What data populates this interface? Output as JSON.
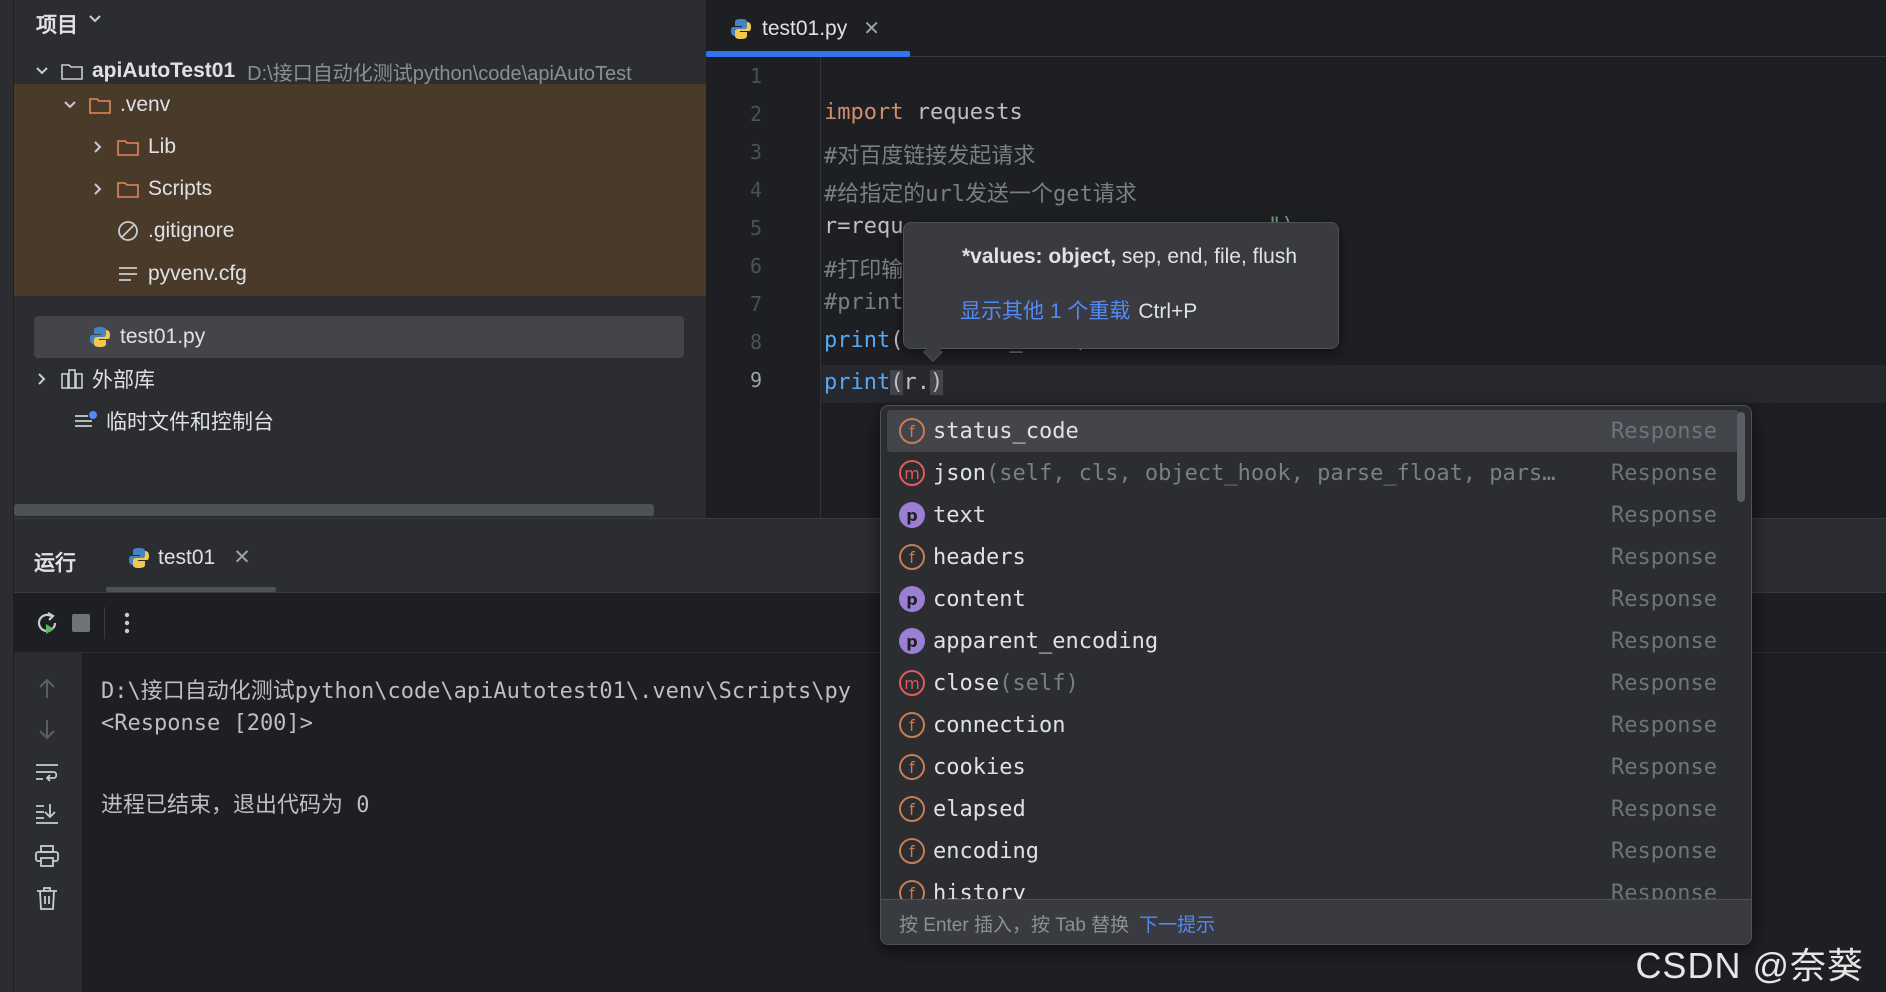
{
  "project": {
    "title": "项目",
    "root": {
      "name": "apiAutoTest01",
      "path": "D:\\接口自动化测试python\\code\\apiAutoTest"
    },
    "tree": [
      {
        "label": ".venv"
      },
      {
        "label": "Lib"
      },
      {
        "label": "Scripts"
      },
      {
        "label": ".gitignore"
      },
      {
        "label": "pyvenv.cfg"
      },
      {
        "label": "test01.py"
      },
      {
        "label": "外部库"
      },
      {
        "label": "临时文件和控制台"
      }
    ]
  },
  "editor": {
    "tab": {
      "label": "test01.py",
      "close": "✕"
    },
    "line_numbers": [
      "1",
      "2",
      "3",
      "4",
      "5",
      "6",
      "7",
      "8",
      "9"
    ],
    "lines": {
      "l2_kw": "import",
      "l2_rest": " requests",
      "l3": "#对百度链接发起请求",
      "l4": "#给指定的url发送一个get请求",
      "l5_a": "r=requ",
      "l5_b": "\")",
      "l6": "#打印输",
      "l7": "#print",
      "l8_fn": "print",
      "l8_rest": "(r.status_code)",
      "l9_fn": "print",
      "l9_open": "(",
      "l9_mid": "r.",
      "l9_close": ")"
    }
  },
  "param_info": {
    "signature_bold": "*values: object,",
    "signature_rest": " sep, end, file, flush",
    "more_link": "显示其他 1 个重载",
    "more_key": "Ctrl+P"
  },
  "completion": {
    "items": [
      {
        "kind": "f",
        "name": "status_code",
        "params": "",
        "type": "Response"
      },
      {
        "kind": "m",
        "name": "json",
        "params": "(self, cls, object_hook, parse_float, pars…",
        "type": "Response"
      },
      {
        "kind": "p",
        "name": "text",
        "params": "",
        "type": "Response"
      },
      {
        "kind": "f",
        "name": "headers",
        "params": "",
        "type": "Response"
      },
      {
        "kind": "p",
        "name": "content",
        "params": "",
        "type": "Response"
      },
      {
        "kind": "p",
        "name": "apparent_encoding",
        "params": "",
        "type": "Response"
      },
      {
        "kind": "m",
        "name": "close",
        "params": "(self)",
        "type": "Response"
      },
      {
        "kind": "f",
        "name": "connection",
        "params": "",
        "type": "Response"
      },
      {
        "kind": "f",
        "name": "cookies",
        "params": "",
        "type": "Response"
      },
      {
        "kind": "f",
        "name": "elapsed",
        "params": "",
        "type": "Response"
      },
      {
        "kind": "f",
        "name": "encoding",
        "params": "",
        "type": "Response"
      },
      {
        "kind": "f",
        "name": "history",
        "params": "",
        "type": "Response"
      }
    ],
    "footer_text": "按 Enter 插入，按 Tab 替换",
    "footer_link": "下一提示"
  },
  "run": {
    "title": "运行",
    "tab_label": "test01",
    "close": "✕",
    "output": [
      "D:\\接口自动化测试python\\code\\apiAutotest01\\.venv\\Scripts\\py",
      "<Response [200]>",
      "",
      "进程已结束，退出代码为 0"
    ]
  },
  "watermark": "CSDN @奈葵",
  "colors": {
    "accent": "#3574f0",
    "keyword": "#cf8e6d",
    "function": "#56a8f5",
    "comment": "#7a7e85",
    "venv_bg": "#4a3a2a"
  }
}
